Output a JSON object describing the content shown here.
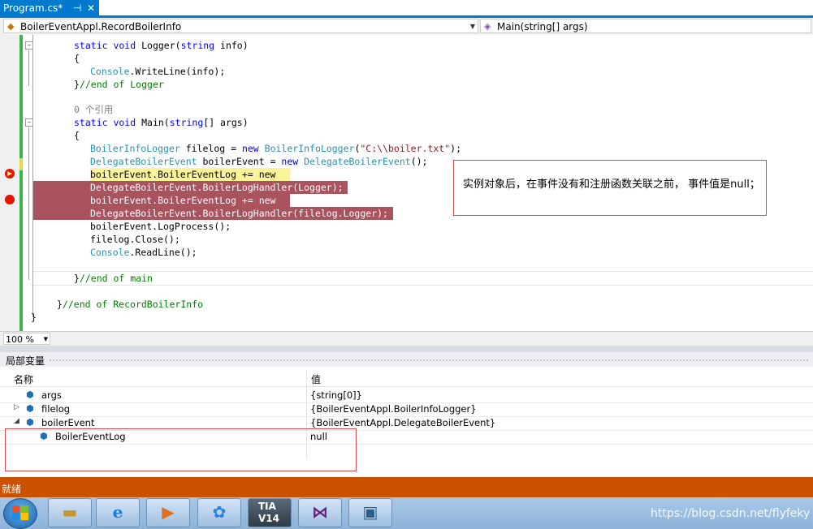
{
  "tab": {
    "title": "Program.cs*",
    "pin_glyph": "⊣",
    "close_glyph": "✕"
  },
  "nav": {
    "class_combo": "BoilerEventAppl.RecordBoilerInfo",
    "member_combo": "Main(string[] args)"
  },
  "code": {
    "logger_sig_kw1": "static void ",
    "logger_sig_name": "Logger(",
    "logger_sig_kw2": "string",
    "logger_sig_rest": " info)",
    "open_brace": "{",
    "console_type": "Console",
    "console_call": ".WriteLine(info);",
    "end_logger_brace": "}",
    "end_logger_comment": "//end of Logger",
    "ref_count": "0 个引用",
    "main_sig_kw1": "static void ",
    "main_sig_name": "Main(",
    "main_sig_kw2": "string",
    "main_sig_rest": "[] args)",
    "line_filelog_type": "BoilerInfoLogger",
    "line_filelog_mid": " filelog = ",
    "line_filelog_new": "new ",
    "line_filelog_type2": "BoilerInfoLogger",
    "line_filelog_paren": "(",
    "line_filelog_str": "\"C:\\\\boiler.txt\"",
    "line_filelog_end": ");",
    "line_event_type": "DelegateBoilerEvent",
    "line_event_mid": " boilerEvent = ",
    "line_event_new": "new ",
    "line_event_type2": "DelegateBoilerEvent",
    "line_event_end": "();",
    "line_add1": "boilerEvent.BoilerEventLog += new ",
    "line_handler1": "DelegateBoilerEvent.BoilerLogHandler(Logger);",
    "line_add2": "boilerEvent.BoilerEventLog += new ",
    "line_handler2": "DelegateBoilerEvent.BoilerLogHandler(filelog.Logger);",
    "line_process": "boilerEvent.LogProcess();",
    "line_close": "filelog.Close();",
    "line_readline_type": "Console",
    "line_readline_rest": ".ReadLine();",
    "end_main_brace": "}",
    "end_main_comment": "//end of main",
    "end_class_brace": "}",
    "end_class_comment": "//end of RecordBoilerInfo",
    "end_ns_brace": "}"
  },
  "annotation": "实例对象后，在事件没有和注册函数关联之前， 事件值是null；",
  "zoom": {
    "value": "100 %"
  },
  "locals": {
    "title": "局部变量",
    "col_name": "名称",
    "col_value": "值",
    "rows": [
      {
        "name": "args",
        "value": "{string[0]}",
        "expander": "",
        "icon": "object-icon"
      },
      {
        "name": "filelog",
        "value": "{BoilerEventAppl.BoilerInfoLogger}",
        "expander": "▷",
        "icon": "object-icon"
      },
      {
        "name": "boilerEvent",
        "value": "{BoilerEventAppl.DelegateBoilerEvent}",
        "expander": "◢",
        "icon": "object-icon"
      },
      {
        "name": "BoilerEventLog",
        "value": "null",
        "expander": "",
        "icon": "event-icon"
      }
    ]
  },
  "status": {
    "text": "就绪"
  },
  "taskbar": {
    "tia_label_1": "TIA",
    "tia_label_2": "V14",
    "watermark": "https://blog.csdn.net/flyfeky"
  },
  "colors": {
    "accent": "#007acc",
    "status_bar": "#ca5100",
    "breakpoint": "#e51400",
    "current_line": "#fbf39a",
    "breakpoint_line": "#a9535e",
    "annotation_border": "#cf4a4a"
  }
}
